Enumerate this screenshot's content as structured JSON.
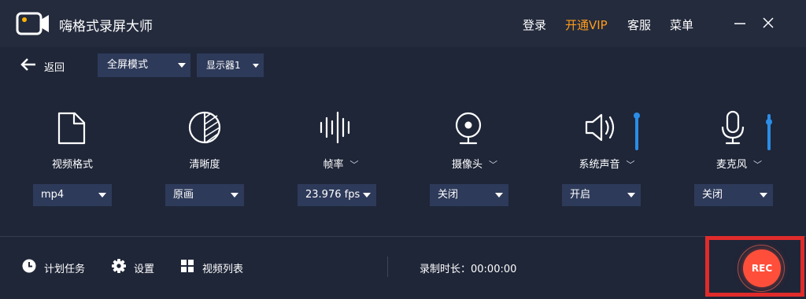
{
  "app": {
    "title": "嗨格式录屏大师"
  },
  "topnav": {
    "login": "登录",
    "vip": "开通VIP",
    "service": "客服",
    "menu": "菜单"
  },
  "colors": {
    "accent": "#2b8de6",
    "vip": "#ff9c1a",
    "rec": "#ff4f3b",
    "highlight_frame": "#e02b2b"
  },
  "toolbar": {
    "back_label": "返回",
    "mode_select": "全屏模式",
    "display_select": "显示器1"
  },
  "settings": [
    {
      "label": "视频格式",
      "icon": "file-icon",
      "value": "mp4",
      "has_chevron": false
    },
    {
      "label": "清晰度",
      "icon": "contrast-icon",
      "value": "原画",
      "has_chevron": false
    },
    {
      "label": "帧率",
      "icon": "waveform-icon",
      "value": "23.976 fps",
      "has_chevron": true
    },
    {
      "label": "摄像头",
      "icon": "webcam-icon",
      "value": "关闭",
      "has_chevron": true
    },
    {
      "label": "系统声音",
      "icon": "speaker-icon",
      "value": "开启",
      "has_chevron": true
    },
    {
      "label": "麦克风",
      "icon": "microphone-icon",
      "value": "关闭",
      "has_chevron": true
    }
  ],
  "footer": {
    "schedule": "计划任务",
    "settings": "设置",
    "video_list": "视频列表",
    "record_duration": "录制时长：00:00:00",
    "rec_button": "REC"
  }
}
